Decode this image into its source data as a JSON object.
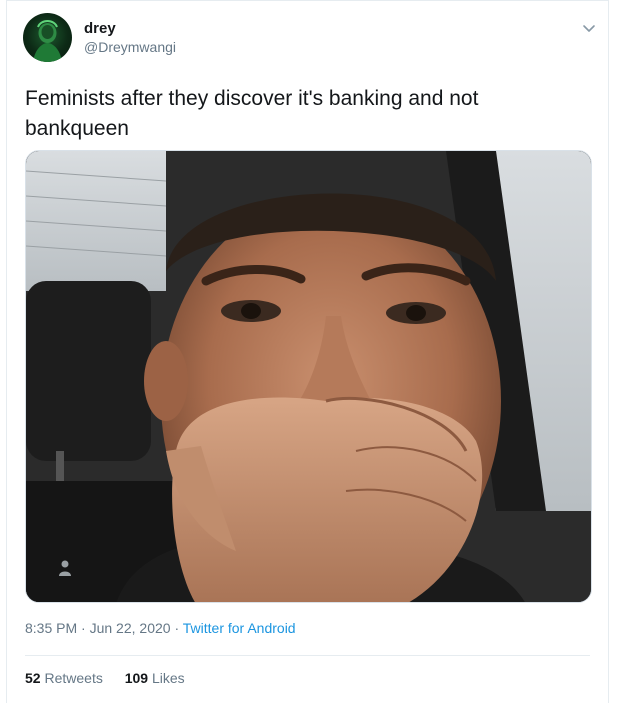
{
  "author": {
    "display_name": "drey",
    "handle": "@Dreymwangi"
  },
  "tweet": {
    "text": "Feminists after they discover it's banking and not bankqueen",
    "time": "8:35 PM",
    "separator": "·",
    "date": "Jun 22, 2020",
    "app": "Twitter for Android"
  },
  "stats": {
    "retweets_count": "52",
    "retweets_label": "Retweets",
    "likes_count": "109",
    "likes_label": "Likes"
  },
  "icons": {
    "menu": "chevron-down-icon",
    "media_person": "person-icon"
  },
  "colors": {
    "link": "#1b95e0",
    "secondary_text": "#657786",
    "primary_text": "#14171a"
  }
}
